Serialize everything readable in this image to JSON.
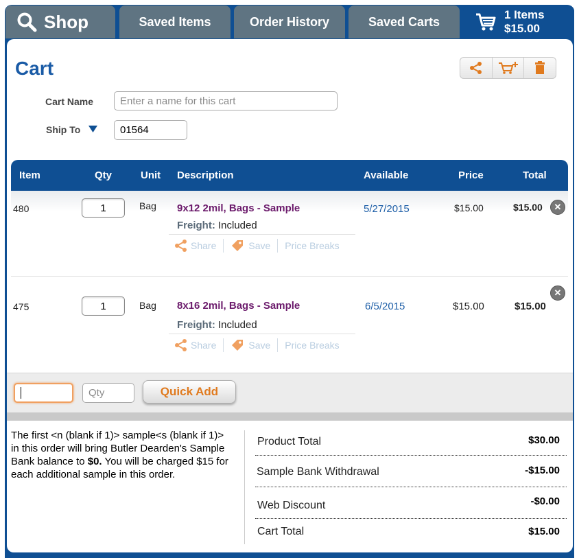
{
  "tabs": {
    "shop": "Shop",
    "saved_items": "Saved Items",
    "order_history": "Order History",
    "saved_carts": "Saved Carts",
    "cart_items": "1 Items",
    "cart_total": "$15.00"
  },
  "page": {
    "title": "Cart"
  },
  "form": {
    "cart_name_label": "Cart Name",
    "cart_name_placeholder": "Enter a name for this cart",
    "ship_to_label": "Ship To",
    "ship_to_value": "01564"
  },
  "table": {
    "headers": {
      "item": "Item",
      "qty": "Qty",
      "unit": "Unit",
      "description": "Description",
      "available": "Available",
      "price": "Price",
      "total": "Total"
    },
    "rows": [
      {
        "item": "480",
        "qty": "1",
        "unit": "Bag",
        "description": "9x12 2mil, Bags - ",
        "sample": "Sample",
        "freight_label": "Freight:",
        "freight_value": "Included",
        "available": "5/27/2015",
        "price": "$15.00",
        "total": "$15.00"
      },
      {
        "item": "475",
        "qty": "1",
        "unit": "Bag",
        "description": "8x16 2mil, Bags - ",
        "sample": "Sample",
        "freight_label": "Freight:",
        "freight_value": "Included",
        "available": "6/5/2015",
        "price": "$15.00",
        "total": "$15.00"
      }
    ],
    "actions": {
      "share": "Share",
      "save": "Save",
      "price_breaks": "Price Breaks"
    }
  },
  "quick_add": {
    "qty_placeholder": "Qty",
    "button": "Quick Add"
  },
  "note": {
    "text": "The first <n (blank if 1)> sample<s (blank if 1)> in this order will bring Butler Dearden's Sample Bank balance to ",
    "amount": "$0.",
    "text2": " You will be charged $15 for each additional sample in this order."
  },
  "summary": {
    "product_total_label": "Product Total",
    "product_total": "$30.00",
    "withdrawal_label": "Sample Bank Withdrawal",
    "withdrawal": "-$15.00",
    "discount_label": "Web Discount",
    "discount": "-$0.00",
    "cart_total_label": "Cart Total",
    "cart_total": "$15.00"
  },
  "colors": {
    "brand_blue": "#0f4f93",
    "tab_gray": "#5f7482",
    "accent_orange": "#e07a1e",
    "desc_purple": "#6b1a6b"
  }
}
